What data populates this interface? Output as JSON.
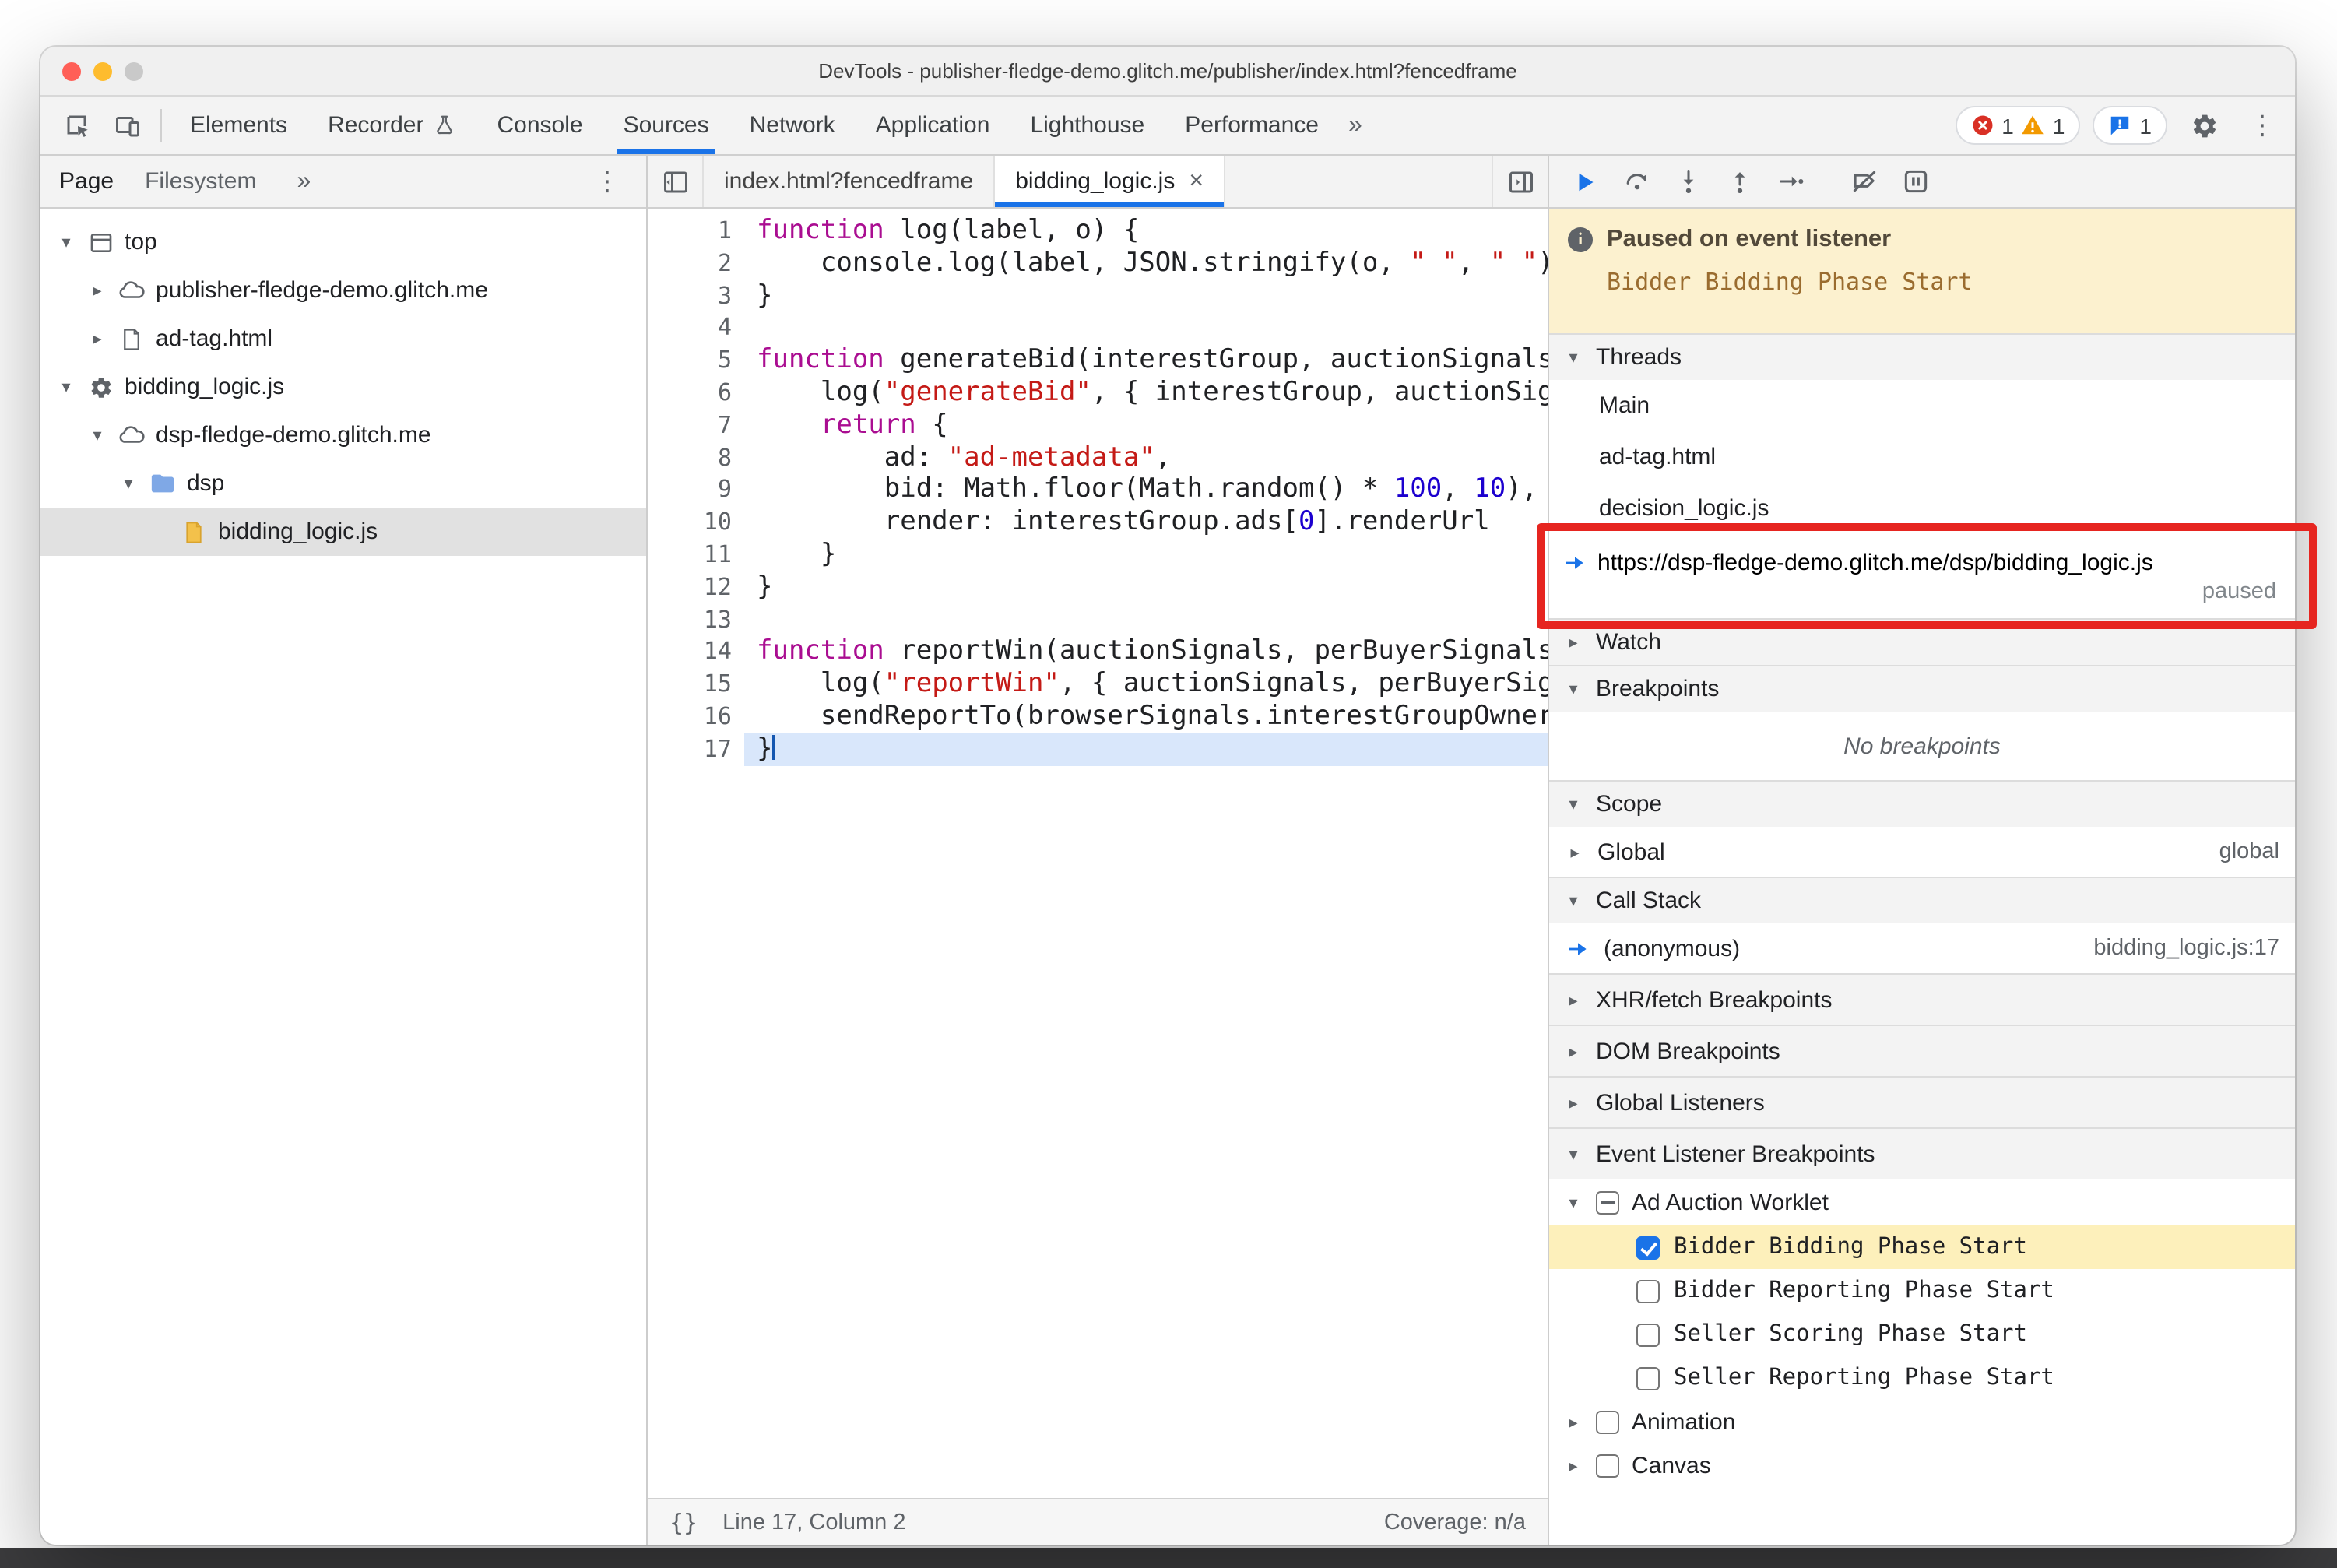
{
  "glyphs": {
    "dots": "⋮",
    "more": "»",
    "close": "×",
    "tri_down": "▾",
    "tri_right": "▸"
  },
  "window": {
    "title": "DevTools - publisher-fledge-demo.glitch.me/publisher/index.html?fencedframe"
  },
  "toolbar": {
    "tabs": [
      {
        "label": "Elements"
      },
      {
        "label": "Recorder"
      },
      {
        "label": "Console"
      },
      {
        "label": "Sources"
      },
      {
        "label": "Network"
      },
      {
        "label": "Application"
      },
      {
        "label": "Lighthouse"
      },
      {
        "label": "Performance"
      }
    ],
    "errors": "1",
    "warnings": "1",
    "issues": "1"
  },
  "navigator": {
    "page_tab": "Page",
    "filesystem_tab": "Filesystem",
    "tree": [
      {
        "label": "top"
      },
      {
        "label": "publisher-fledge-demo.glitch.me"
      },
      {
        "label": "ad-tag.html"
      },
      {
        "label": "bidding_logic.js"
      },
      {
        "label": "dsp-fledge-demo.glitch.me"
      },
      {
        "label": "dsp"
      },
      {
        "label": "bidding_logic.js"
      }
    ]
  },
  "editor": {
    "tabs": [
      {
        "label": "index.html?fencedframe"
      },
      {
        "label": "bidding_logic.js"
      }
    ],
    "current_line": 17,
    "status": {
      "pretty": "{}",
      "position": "Line 17, Column 2",
      "coverage": "Coverage: n/a"
    },
    "lines": [
      {
        "n": 1,
        "seg": [
          {
            "c": "kw",
            "t": "function"
          },
          {
            "t": " log(label, o) {"
          }
        ]
      },
      {
        "n": 2,
        "seg": [
          {
            "t": "    console.log(label, JSON.stringify(o, "
          },
          {
            "c": "str",
            "t": "\" \""
          },
          {
            "t": ", "
          },
          {
            "c": "str",
            "t": "\" \""
          },
          {
            "t": "));"
          }
        ]
      },
      {
        "n": 3,
        "seg": [
          {
            "t": "}"
          }
        ]
      },
      {
        "n": 4,
        "seg": []
      },
      {
        "n": 5,
        "seg": [
          {
            "c": "kw",
            "t": "function"
          },
          {
            "t": " generateBid(interestGroup, auctionSignals, perBuyerSignals, trustedBiddingSignals, browserSignals) {"
          }
        ]
      },
      {
        "n": 6,
        "seg": [
          {
            "t": "    log("
          },
          {
            "c": "str",
            "t": "\"generateBid\""
          },
          {
            "t": ", { interestGroup, auctionSignals, perBuyerSignals, trustedBiddingSignals });"
          }
        ]
      },
      {
        "n": 7,
        "seg": [
          {
            "t": "    "
          },
          {
            "c": "kw",
            "t": "return"
          },
          {
            "t": " {"
          }
        ]
      },
      {
        "n": 8,
        "seg": [
          {
            "t": "        ad: "
          },
          {
            "c": "str",
            "t": "\"ad-metadata\""
          },
          {
            "t": ","
          }
        ]
      },
      {
        "n": 9,
        "seg": [
          {
            "t": "        bid: Math.floor(Math.random() * "
          },
          {
            "c": "num",
            "t": "100"
          },
          {
            "t": ", "
          },
          {
            "c": "num",
            "t": "10"
          },
          {
            "t": "),"
          }
        ]
      },
      {
        "n": 10,
        "seg": [
          {
            "t": "        render: interestGroup.ads["
          },
          {
            "c": "num",
            "t": "0"
          },
          {
            "t": "].renderUrl"
          }
        ]
      },
      {
        "n": 11,
        "seg": [
          {
            "t": "    }"
          }
        ]
      },
      {
        "n": 12,
        "seg": [
          {
            "t": "}"
          }
        ]
      },
      {
        "n": 13,
        "seg": []
      },
      {
        "n": 14,
        "seg": [
          {
            "c": "kw",
            "t": "function"
          },
          {
            "t": " reportWin(auctionSignals, perBuyerSignals, browserSignals) {"
          }
        ]
      },
      {
        "n": 15,
        "seg": [
          {
            "t": "    log("
          },
          {
            "c": "str",
            "t": "\"reportWin\""
          },
          {
            "t": ", { auctionSignals, perBuyerSignals, browserSignals });"
          }
        ]
      },
      {
        "n": 16,
        "seg": [
          {
            "t": "    sendReportTo(browserSignals.interestGroupOwner);"
          }
        ]
      },
      {
        "n": 17,
        "seg": [
          {
            "t": "}"
          }
        ]
      }
    ]
  },
  "debugger": {
    "banner": {
      "title": "Paused on event listener",
      "reason": "Bidder Bidding Phase Start"
    },
    "threads": {
      "title": "Threads",
      "items": [
        {
          "label": "Main"
        },
        {
          "label": "ad-tag.html"
        },
        {
          "label": "decision_logic.js"
        }
      ],
      "active": {
        "label": "https://dsp-fledge-demo.glitch.me/dsp/bidding_logic.js",
        "status": "paused"
      }
    },
    "watch": {
      "title": "Watch"
    },
    "breakpoints": {
      "title": "Breakpoints",
      "empty": "No breakpoints"
    },
    "scope": {
      "title": "Scope",
      "name": "Global",
      "value": "global"
    },
    "callstack": {
      "title": "Call Stack",
      "name": "(anonymous)",
      "location": "bidding_logic.js:17"
    },
    "xhr": {
      "title": "XHR/fetch Breakpoints"
    },
    "dom": {
      "title": "DOM Breakpoints"
    },
    "global_listeners": {
      "title": "Global Listeners"
    },
    "elb": {
      "title": "Event Listener Breakpoints",
      "group": "Ad Auction Worklet",
      "children": [
        "Bidder Bidding Phase Start",
        "Bidder Reporting Phase Start",
        "Seller Scoring Phase Start",
        "Seller Reporting Phase Start"
      ],
      "others": [
        "Animation",
        "Canvas"
      ]
    }
  }
}
